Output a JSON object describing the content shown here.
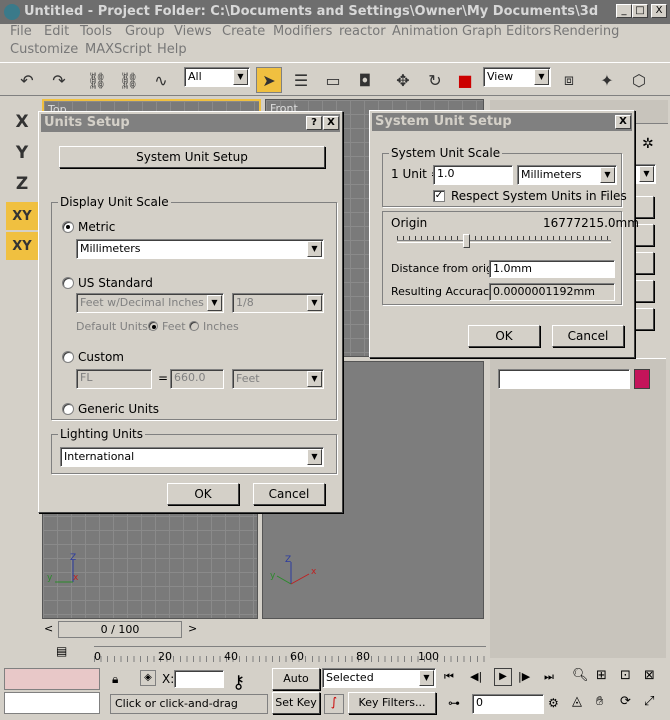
{
  "window": {
    "title": "Untitled    - Project Folder: C:\\Documents and Settings\\Owner\\My Documents\\3d",
    "min": "_",
    "max": "□",
    "close": "X"
  },
  "menu": {
    "items": [
      "File",
      "Edit",
      "Tools",
      "Group",
      "Views",
      "Create",
      "Modifiers",
      "reactor",
      "Animation",
      "Graph Editors",
      "Rendering",
      "Customize",
      "MAXScript",
      "Help"
    ]
  },
  "toolbar": {
    "filter": "All",
    "refcoord": "View"
  },
  "axes": {
    "x": "X",
    "y": "Y",
    "z": "Z",
    "xy": "XY",
    "xy2": "XY"
  },
  "viewports": {
    "top": "Top",
    "front": "Front"
  },
  "units_setup": {
    "title": "Units Setup",
    "help": "?",
    "close": "X",
    "system_button": "System Unit Setup",
    "display_group": "Display Unit Scale",
    "metric": "Metric",
    "metric_value": "Millimeters",
    "us_standard": "US Standard",
    "us_value": "Feet w/Decimal Inches",
    "us_fraction": "1/8",
    "default_units": "Default Units:",
    "feet": "Feet",
    "inches": "Inches",
    "custom": "Custom",
    "custom_name": "FL",
    "equals": "=",
    "custom_value": "660.0",
    "custom_unit": "Feet",
    "generic": "Generic Units",
    "lighting_group": "Lighting Units",
    "lighting_value": "International",
    "ok": "OK",
    "cancel": "Cancel"
  },
  "system_unit": {
    "title": "System Unit Setup",
    "close": "X",
    "group": "System Unit Scale",
    "unit_label": "1 Unit =",
    "unit_value": "1.0",
    "unit_type": "Millimeters",
    "respect": "Respect System Units in Files",
    "origin_label": "Origin",
    "origin_value": "16777215.0mm",
    "distance_label": "Distance from origin:",
    "distance_value": "1.0mm",
    "accuracy_label": "Resulting Accuracy:",
    "accuracy_value": "0.0000001192mm",
    "ok": "OK",
    "cancel": "Cancel"
  },
  "timeline": {
    "frame": "0 / 100",
    "ticks": [
      "0",
      "20",
      "40",
      "60",
      "80",
      "100"
    ]
  },
  "status": {
    "x_label": "X:",
    "auto_key": "Auto Key",
    "set_key": "Set Key",
    "selected": "Selected",
    "key_filters": "Key Filters...",
    "prompt": "Click or click-and-drag",
    "frame_value": "0"
  },
  "colors": {
    "swatch": "#c4145a",
    "status_pink": "#e8c8c8",
    "accent_yellow": "#f0c040"
  }
}
